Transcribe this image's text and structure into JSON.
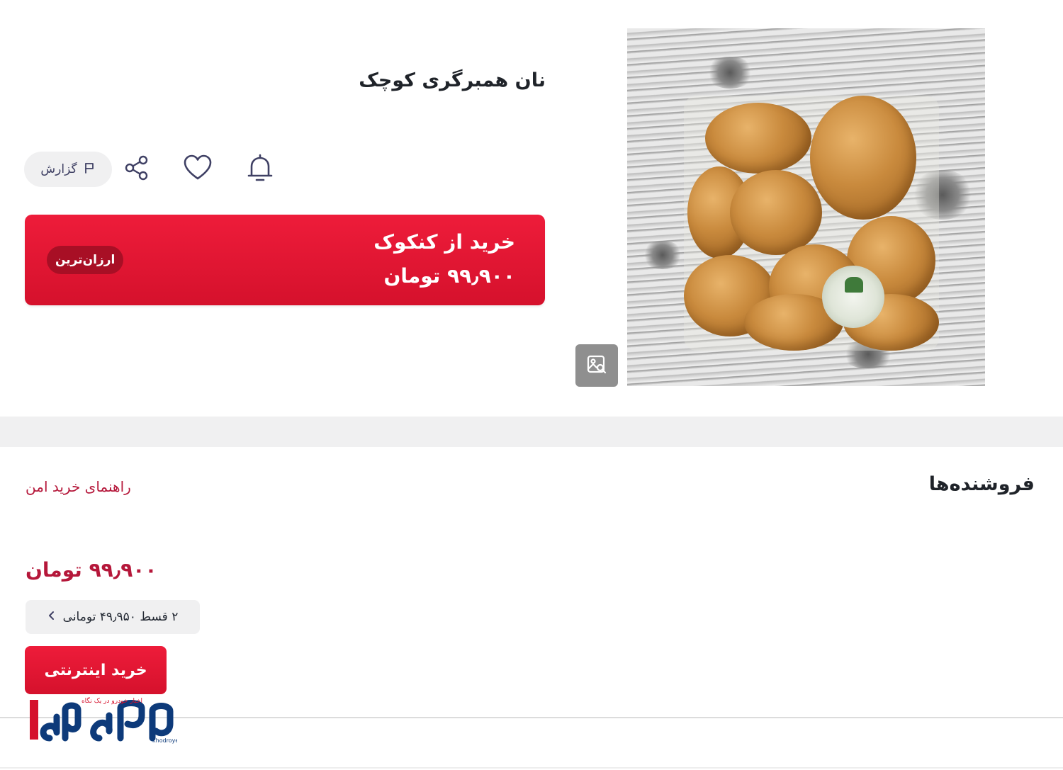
{
  "product": {
    "title": "نان همبرگری کوچک"
  },
  "actions": {
    "report_label": "گزارش"
  },
  "buy_banner": {
    "line1": "خرید از کنکوک",
    "line2": "۹۹٫۹۰۰ تومان",
    "badge": "ارزان‌ترین"
  },
  "sellers": {
    "title": "فروشنده‌ها",
    "safe_guide": "راهنمای خرید امن",
    "price": "۹۹٫۹۰۰ تومان",
    "installment": "۲ قسط ۴۹٫۹۵۰ تومانی",
    "buy_button": "خرید اینترنتی"
  },
  "watermark": {
    "tagline": "اخبار خودرو در یک نگاه",
    "domain": "khodroyek.ir"
  },
  "colors": {
    "accent_red": "#e3172f",
    "text_red": "#b5173a",
    "badge_red": "#a80f25",
    "pill_gray": "#f0f0f1"
  }
}
